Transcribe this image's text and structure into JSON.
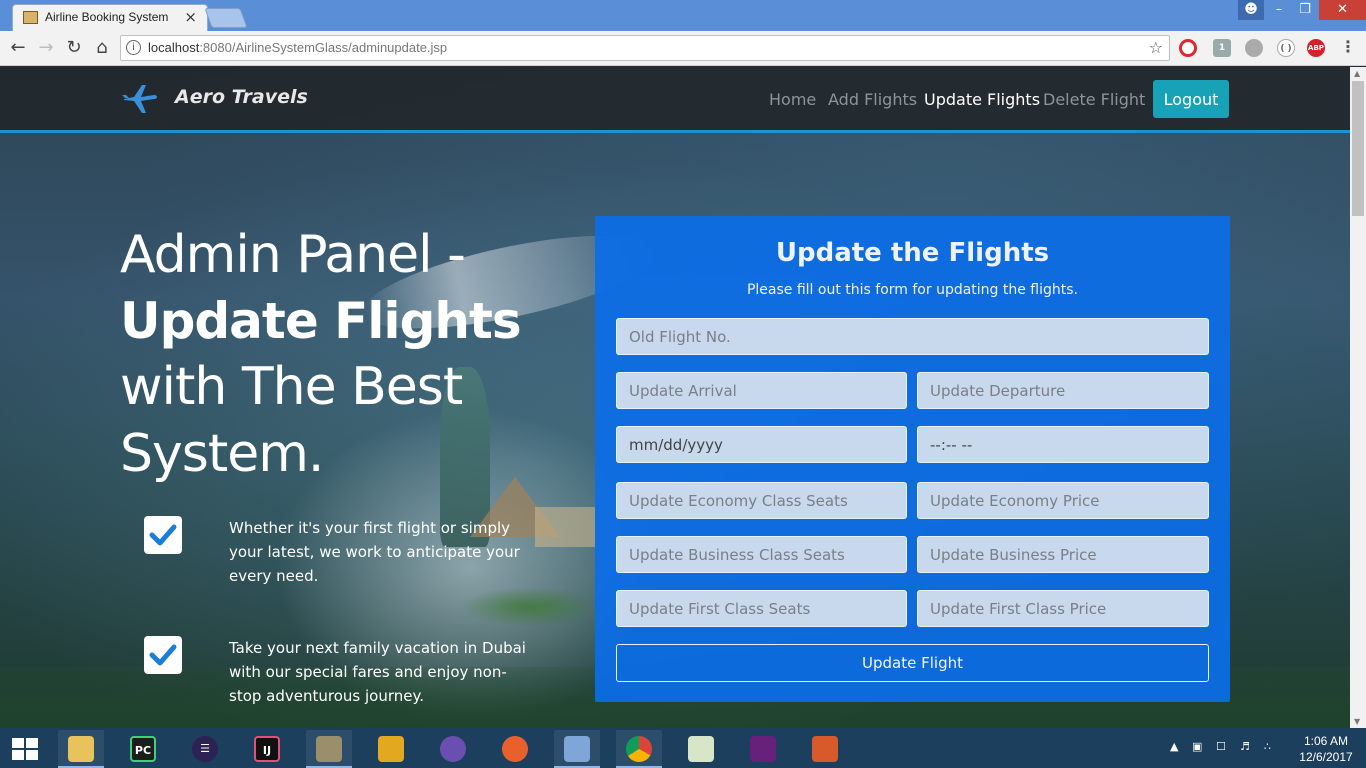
{
  "browser": {
    "tab_title": "Airline Booking System",
    "tab_close": "×",
    "url_host": "localhost",
    "url_rest": ":8080/AirlineSystemGlass/adminupdate.jsp",
    "ext_abp": "ABP",
    "ext_badge": "1"
  },
  "site": {
    "brand": "Aero Travels",
    "nav": {
      "home": "Home",
      "add": "Add Flights",
      "update": "Update Flights",
      "delete": "Delete Flight",
      "logout": "Logout"
    },
    "accent": "#17a2b8"
  },
  "hero": {
    "line1": "Admin Panel -",
    "line2": "Update Flights",
    "line3": "with The Best",
    "line4": "System."
  },
  "features": [
    {
      "text": "Whether it's your first flight or simply your latest, we work to anticipate your every need."
    },
    {
      "text": "Take your next family vacation in Dubai with our special fares and enjoy non-stop adventurous journey."
    }
  ],
  "form": {
    "title": "Update the Flights",
    "subtitle": "Please fill out this form for updating the flights.",
    "old_flight_placeholder": "Old Flight No.",
    "arrival_placeholder": "Update Arrival",
    "departure_placeholder": "Update Departure",
    "date_value": "mm/dd/yyyy",
    "time_value": "--:-- --",
    "economy_seats_placeholder": "Update Economy Class Seats",
    "economy_price_placeholder": "Update Economy Price",
    "business_seats_placeholder": "Update Business Class Seats",
    "business_price_placeholder": "Update Business Price",
    "first_seats_placeholder": "Update First Class Seats",
    "first_price_placeholder": "Update First Class Price",
    "submit_label": "Update Flight",
    "panel_color": "#0b6ee8"
  },
  "taskbar": {
    "apps": [
      "file-explorer",
      "pycharm",
      "eclipse",
      "intellij",
      "tools",
      "sublime",
      "app-purple",
      "firefox",
      "virtualbox",
      "chrome",
      "notepad",
      "visual-studio",
      "matlab"
    ],
    "clock_time": "1:06 AM",
    "clock_date": "12/6/2017"
  }
}
